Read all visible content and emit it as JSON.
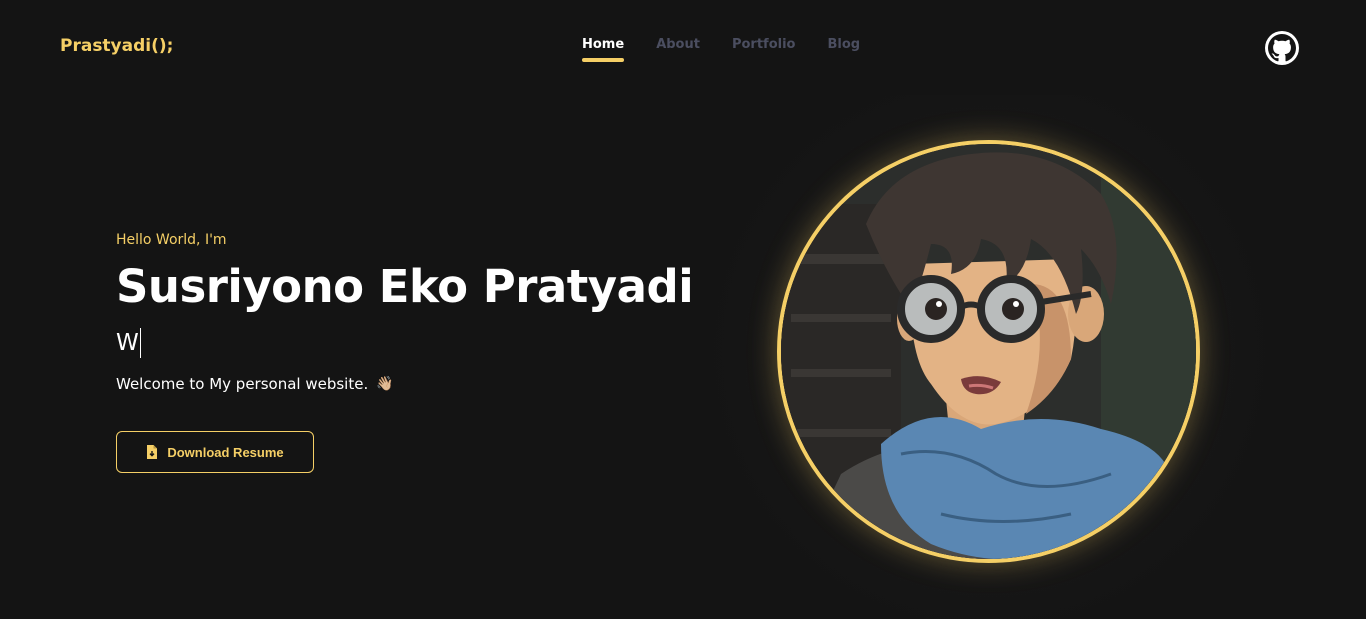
{
  "header": {
    "logo": "Prastyadi();",
    "nav": [
      {
        "label": "Home",
        "active": true
      },
      {
        "label": "About",
        "active": false
      },
      {
        "label": "Portfolio",
        "active": false
      },
      {
        "label": "Blog",
        "active": false
      }
    ],
    "github_icon": "github-icon"
  },
  "hero": {
    "greeting": "Hello World, I'm",
    "name": "Susriyono Eko Pratyadi",
    "typed_text": "W",
    "welcome": "Welcome to My personal website.",
    "wave_emoji": "👋🏼",
    "button_label": "Download Resume",
    "button_icon": "file-icon"
  },
  "colors": {
    "accent": "#f5cf66",
    "background": "#141414",
    "nav_inactive": "#4b4e60"
  }
}
